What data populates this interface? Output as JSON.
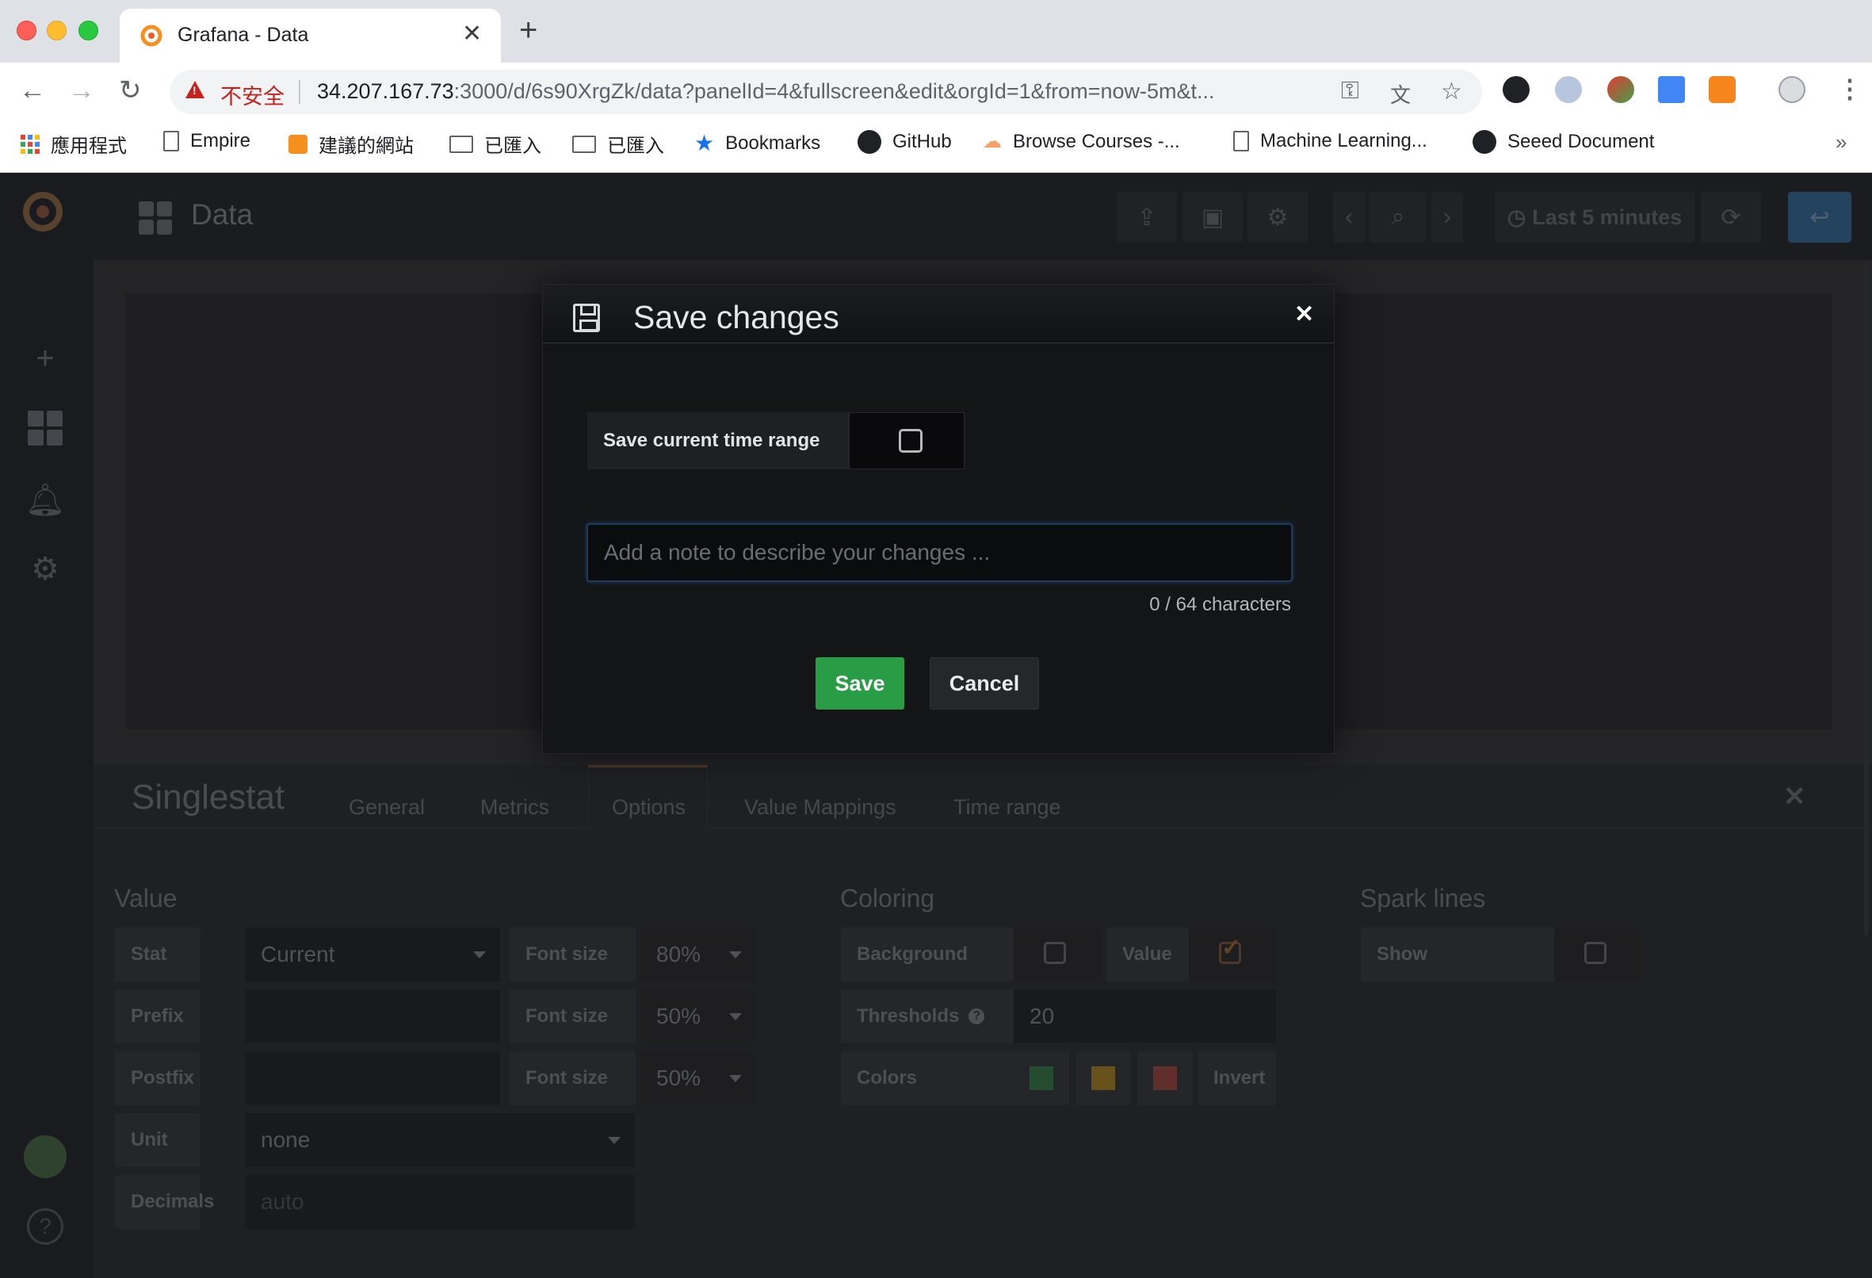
{
  "browser": {
    "tab_title": "Grafana - Data",
    "insecure_label": "不安全",
    "url_host": "34.207.167.73",
    "url_rest": ":3000/d/6s90XrgZk/data?panelId=4&fullscreen&edit&orgId=1&from=now-5m&t...",
    "bookmarks": [
      {
        "label": "應用程式",
        "icon": "apps-icon"
      },
      {
        "label": "Empire",
        "icon": "document-icon"
      },
      {
        "label": "建議的網站",
        "icon": "suggested-icon"
      },
      {
        "label": "已匯入",
        "icon": "folder-icon"
      },
      {
        "label": "已匯入",
        "icon": "folder-icon"
      },
      {
        "label": "Bookmarks",
        "icon": "star-icon"
      },
      {
        "label": "GitHub",
        "icon": "github-icon"
      },
      {
        "label": "Browse Courses -...",
        "icon": "cloud-icon"
      },
      {
        "label": "Machine Learning...",
        "icon": "document-icon"
      },
      {
        "label": "Seeed Document",
        "icon": "github-icon"
      }
    ],
    "more_label": "»"
  },
  "grafana": {
    "dashboard_title": "Data",
    "time_picker_label": "Last 5 minutes",
    "editor": {
      "panel_type": "Singlestat",
      "tabs": [
        "General",
        "Metrics",
        "Options",
        "Value Mappings",
        "Time range"
      ],
      "active_tab": "Options",
      "value_section": {
        "title": "Value",
        "stat_label": "Stat",
        "stat_value": "Current",
        "prefix_label": "Prefix",
        "postfix_label": "Postfix",
        "unit_label": "Unit",
        "unit_value": "none",
        "decimals_label": "Decimals",
        "decimals_placeholder": "auto",
        "font_size_label": "Font size",
        "font_sizes": [
          "80%",
          "50%",
          "50%"
        ]
      },
      "coloring_section": {
        "title": "Coloring",
        "background_label": "Background",
        "value_label": "Value",
        "thresholds_label": "Thresholds",
        "thresholds_value": "20",
        "colors_label": "Colors",
        "colors": [
          "#299c46",
          "#e5ac0e",
          "#d44a3a"
        ],
        "invert_label": "Invert"
      },
      "spark_section": {
        "title": "Spark lines",
        "show_label": "Show"
      }
    }
  },
  "modal": {
    "title": "Save changes",
    "time_range_label": "Save current time range",
    "note_placeholder": "Add a note to describe your changes ...",
    "char_count": "0 / 64 characters",
    "save_label": "Save",
    "cancel_label": "Cancel"
  }
}
